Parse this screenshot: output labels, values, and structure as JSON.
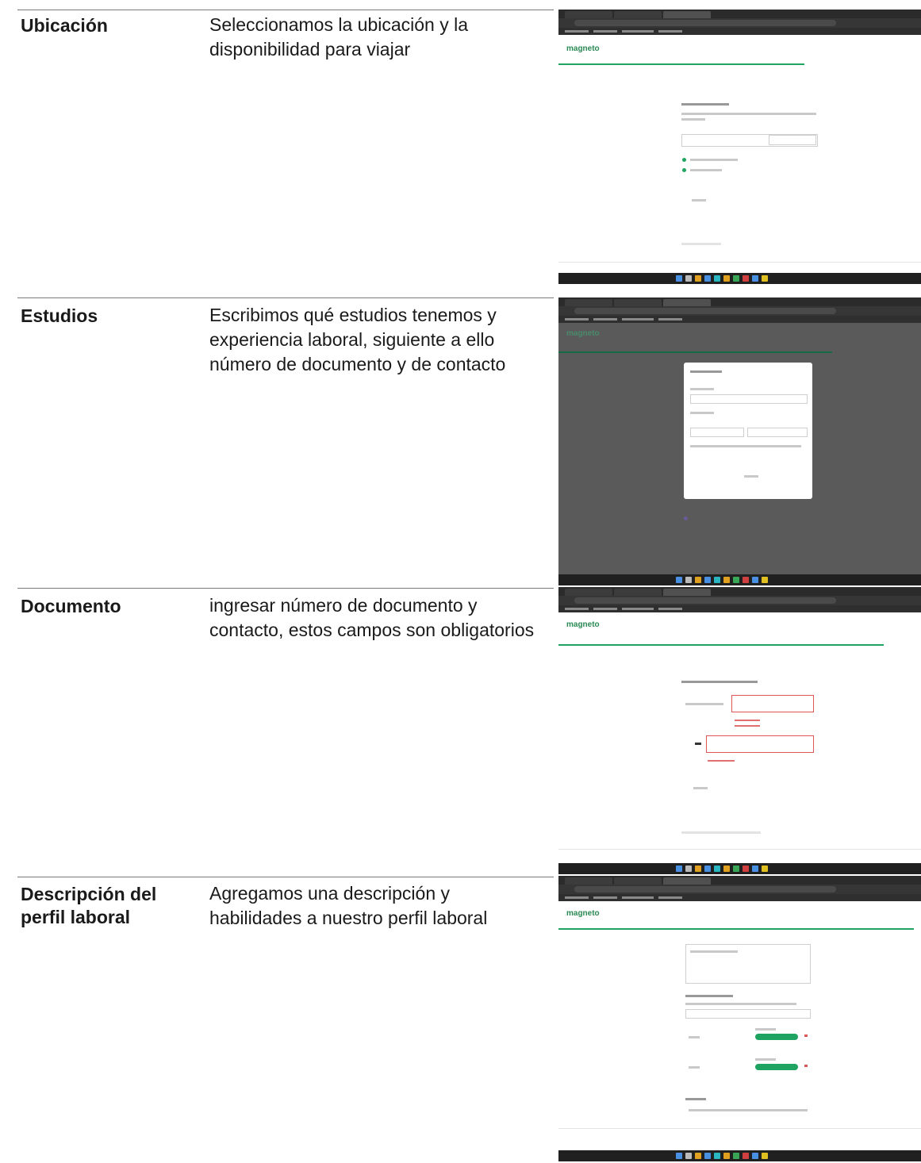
{
  "rows": [
    {
      "title": "Ubicación",
      "description": "Seleccionamos la ubicación y la disponibilidad para viajar"
    },
    {
      "title": "Estudios",
      "description": "Escribimos qué estudios tenemos y experiencia laboral, siguiente a ello número de documento y de contacto"
    },
    {
      "title": "Documento",
      "description": "ingresar número de documento y contacto, estos campos son obligatorios"
    },
    {
      "title": "Descripción del perfil laboral",
      "description": "Agregamos una descripción y habilidades a nuestro perfil laboral"
    }
  ],
  "screenshot": {
    "logo_text": "magneto",
    "accent_color": "#1ea360",
    "dark_button_color": "#1d1b46",
    "overlay_color": "#5a5a5a"
  }
}
